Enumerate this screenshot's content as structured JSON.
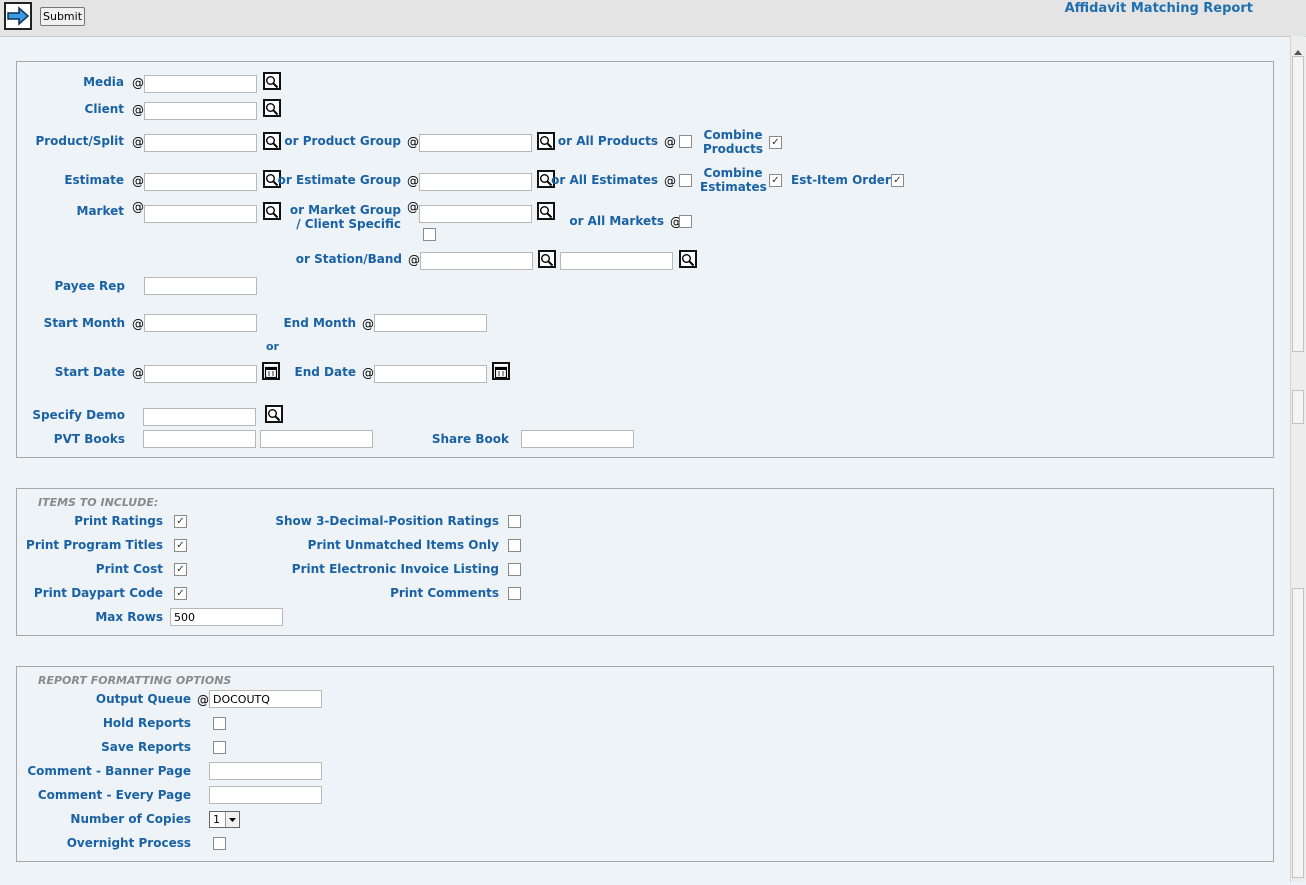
{
  "toolbar": {
    "submit_label": "Submit",
    "report_title": "Affidavit Matching Report"
  },
  "at": "@",
  "or": "or",
  "filters": {
    "media": {
      "label": "Media",
      "value": ""
    },
    "client": {
      "label": "Client",
      "value": ""
    },
    "product": {
      "label": "Product/Split",
      "group_label": "or Product Group",
      "all_label": "or All Products",
      "combine_label": "Combine Products",
      "combine_checked": true
    },
    "estimate": {
      "label": "Estimate",
      "group_label": "or Estimate Group",
      "all_label": "or All Estimates",
      "combine_label": "Combine Estimates",
      "combine_checked": true,
      "est_item_label": "Est-Item Order",
      "est_item_checked": true
    },
    "market": {
      "label": "Market",
      "group_label": "or Market Group / Client Specific",
      "all_label": "or All Markets"
    },
    "station": {
      "label": "or Station/Band"
    },
    "payee_rep": {
      "label": "Payee Rep"
    },
    "start_month": {
      "label": "Start Month"
    },
    "end_month": {
      "label": "End Month"
    },
    "start_date": {
      "label": "Start Date"
    },
    "end_date": {
      "label": "End Date"
    },
    "demo": {
      "label": "Specify Demo"
    },
    "pvt_books": {
      "label": "PVT Books"
    },
    "share_book": {
      "label": "Share Book"
    }
  },
  "items": {
    "section_title": "ITEMS TO INCLUDE:",
    "print_ratings": {
      "label": "Print Ratings",
      "checked": true
    },
    "print_program_titles": {
      "label": "Print Program Titles",
      "checked": true
    },
    "print_cost": {
      "label": "Print Cost",
      "checked": true
    },
    "print_daypart_code": {
      "label": "Print Daypart Code",
      "checked": true
    },
    "max_rows": {
      "label": "Max Rows",
      "value": "500"
    },
    "show_3_decimal": {
      "label": "Show 3-Decimal-Position Ratings",
      "checked": false
    },
    "print_unmatched": {
      "label": "Print Unmatched Items Only",
      "checked": false
    },
    "print_electronic": {
      "label": "Print Electronic Invoice Listing",
      "checked": false
    },
    "print_comments": {
      "label": "Print Comments",
      "checked": false
    }
  },
  "formatting": {
    "section_title": "REPORT FORMATTING OPTIONS",
    "output_queue": {
      "label": "Output Queue",
      "value": "DOCOUTQ"
    },
    "hold_reports": {
      "label": "Hold Reports"
    },
    "save_reports": {
      "label": "Save Reports"
    },
    "comment_banner": {
      "label": "Comment - Banner Page"
    },
    "comment_every": {
      "label": "Comment - Every Page"
    },
    "copies": {
      "label": "Number of Copies",
      "value": "1"
    },
    "overnight": {
      "label": "Overnight Process"
    }
  }
}
